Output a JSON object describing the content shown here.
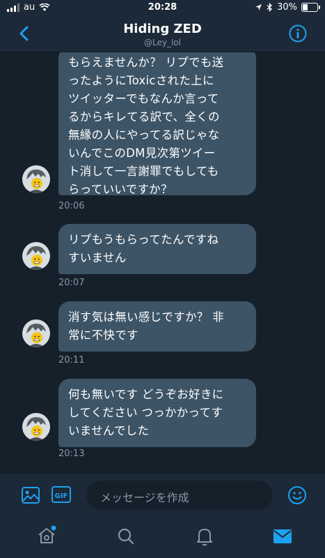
{
  "status": {
    "carrier": "au",
    "time": "20:28",
    "battery": "30%",
    "battery_level": 0.3
  },
  "header": {
    "title": "Hiding ZED",
    "handle": "@Ley_lol"
  },
  "messages": [
    {
      "text": "もらえませんか？ リプでも送\nったようにToxicされた上に\nツイッターでもなんか言って\nるからキレてる訳で、全くの\n無縁の人にやってる訳じゃな\nいんでこのDM見次第ツイー\nト消して一言謝罪でもしても\nらっていいですか？",
      "time": "20:06"
    },
    {
      "text": "リプもうもらってたんですね\nすいません",
      "time": "20:07"
    },
    {
      "text": "消す気は無い感じですか？ 非\n常に不快です",
      "time": "20:11"
    },
    {
      "text": "何も無いです どうぞお好きに\nしてください つっかかってす\nいませんでした",
      "time": "20:13"
    }
  ],
  "composer": {
    "placeholder": "メッセージを作成",
    "gif_label": "GIF"
  },
  "colors": {
    "background": "#15202b",
    "bar": "#1c2938",
    "bubble": "#3d5466",
    "accent": "#1da1f2",
    "muted": "#8899a6"
  },
  "icons": [
    "back-chevron-icon",
    "info-icon",
    "image-icon",
    "gif-icon",
    "emoji-icon",
    "home-icon",
    "search-icon",
    "bell-icon",
    "mail-icon"
  ]
}
